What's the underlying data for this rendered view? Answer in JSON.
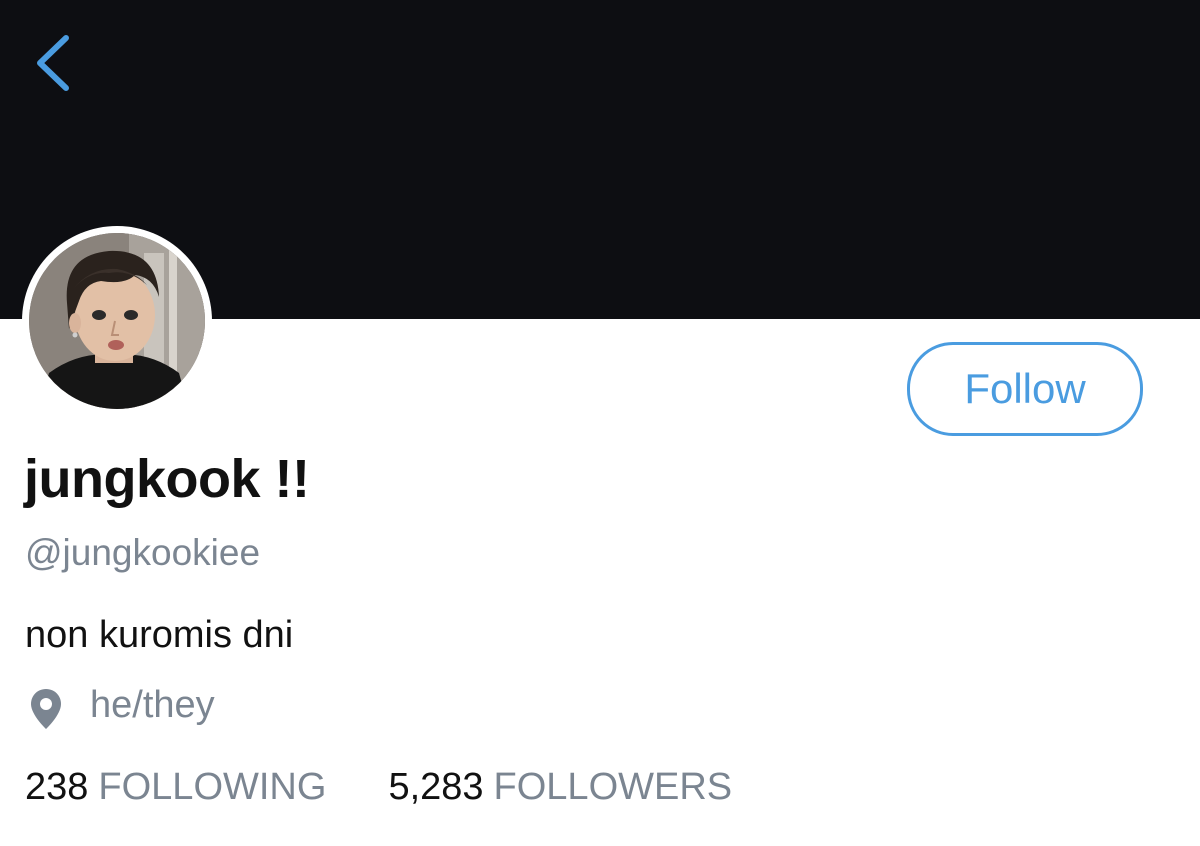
{
  "header": {
    "back_icon": "chevron-left-icon",
    "banner_color": "#0d0e12"
  },
  "profile": {
    "avatar": "profile-photo",
    "follow_label": "Follow",
    "display_name": "jungkook !!",
    "handle": "@jungkookiee",
    "bio": "non kuromis dni",
    "location_icon": "location-pin-icon",
    "location": "he/they"
  },
  "stats": {
    "following_count": "238",
    "following_label": "FOLLOWING",
    "followers_count": "5,283",
    "followers_label": "FOLLOWERS"
  },
  "colors": {
    "accent": "#4a9ce0",
    "secondary_text": "#7b8591",
    "primary_text": "#111111"
  }
}
